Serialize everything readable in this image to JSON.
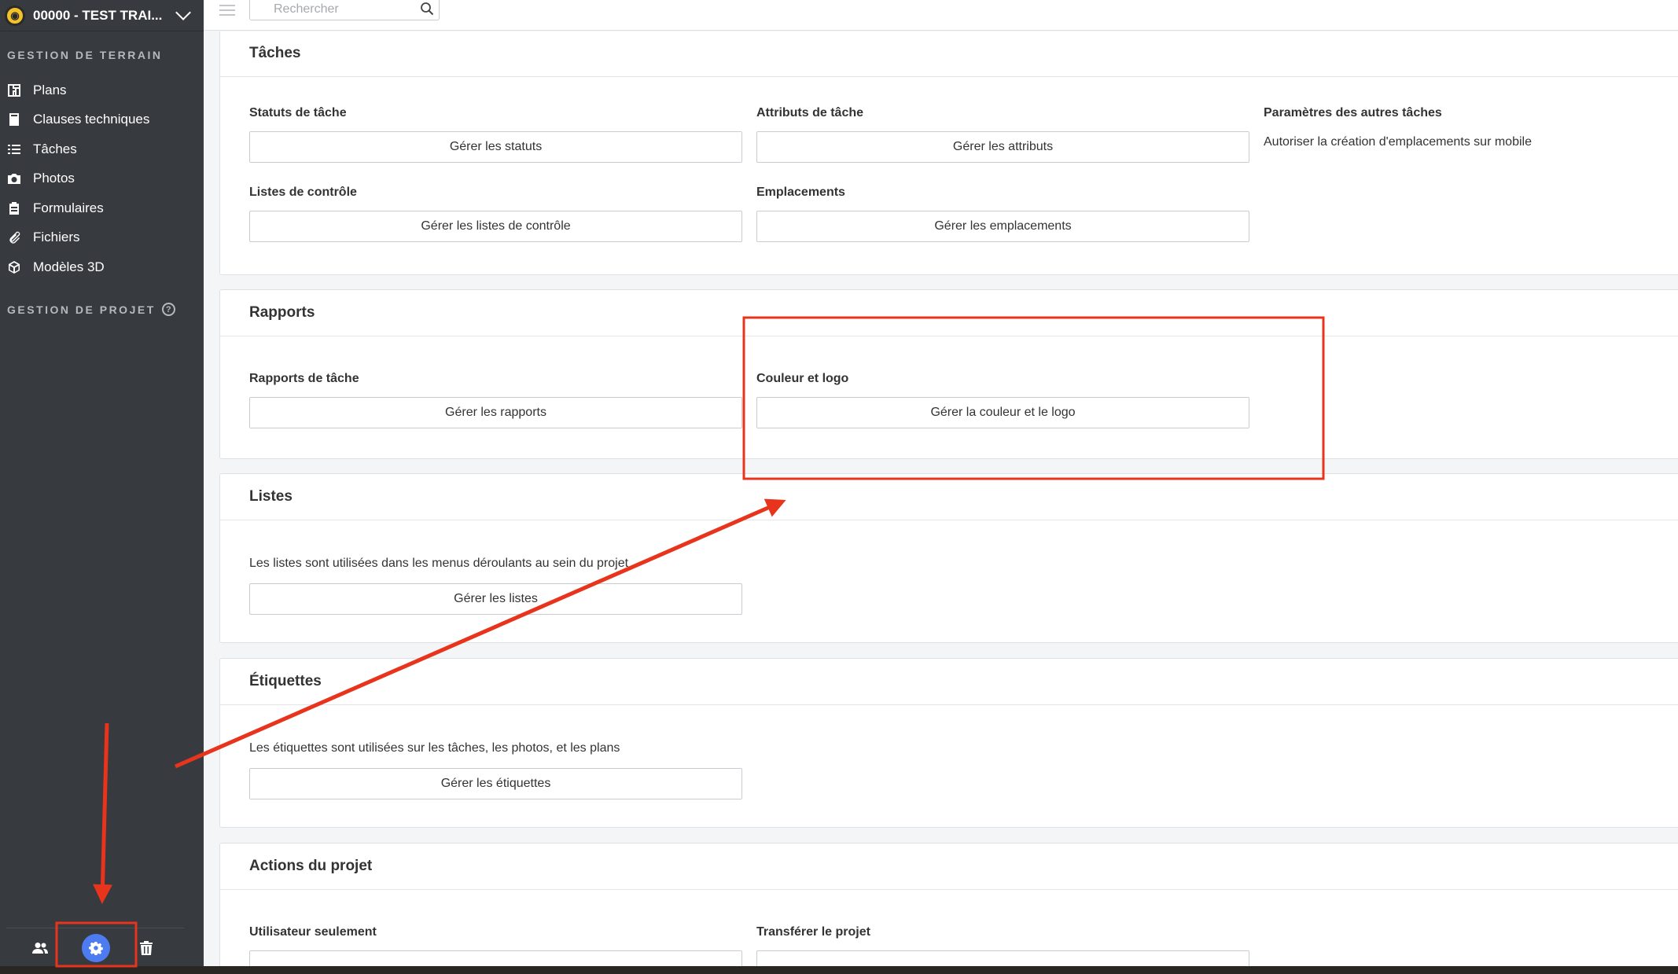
{
  "project": {
    "name": "00000 - TEST TRAI..."
  },
  "sidebar": {
    "section_field": "GESTION DE TERRAIN",
    "section_project": "GESTION DE PROJET",
    "items": [
      {
        "label": "Plans",
        "icon": "plans-icon"
      },
      {
        "label": "Clauses techniques",
        "icon": "book-icon"
      },
      {
        "label": "Tâches",
        "icon": "list-icon"
      },
      {
        "label": "Photos",
        "icon": "camera-icon"
      },
      {
        "label": "Formulaires",
        "icon": "clipboard-icon"
      },
      {
        "label": "Fichiers",
        "icon": "paperclip-icon"
      },
      {
        "label": "Modèles 3D",
        "icon": "cube-icon"
      }
    ]
  },
  "search": {
    "placeholder": "Rechercher"
  },
  "sections": {
    "taches": {
      "title": "Tâches",
      "statuts_label": "Statuts de tâche",
      "statuts_button": "Gérer les statuts",
      "attributs_label": "Attributs de tâche",
      "attributs_button": "Gérer les attributs",
      "autres_label": "Paramètres des autres tâches",
      "autres_text": "Autoriser la création d'emplacements sur mobile",
      "controle_label": "Listes de contrôle",
      "controle_button": "Gérer les listes de contrôle",
      "emplacements_label": "Emplacements",
      "emplacements_button": "Gérer les emplacements"
    },
    "rapports": {
      "title": "Rapports",
      "rapports_label": "Rapports de tâche",
      "rapports_button": "Gérer les rapports",
      "couleur_label": "Couleur et logo",
      "couleur_button": "Gérer la couleur et le logo"
    },
    "listes": {
      "title": "Listes",
      "text": "Les listes sont utilisées dans les menus déroulants au sein du projet",
      "button": "Gérer les listes"
    },
    "etiquettes": {
      "title": "Étiquettes",
      "text": "Les étiquettes sont utilisées sur les tâches, les photos, et les plans",
      "button": "Gérer les étiquettes"
    },
    "actions": {
      "title": "Actions du projet",
      "user_label": "Utilisateur seulement",
      "transfer_label": "Transférer le projet"
    }
  },
  "colors": {
    "sidebar": "#373a3e",
    "accent": "#4d7cf1",
    "annotation": "#e8341c"
  }
}
